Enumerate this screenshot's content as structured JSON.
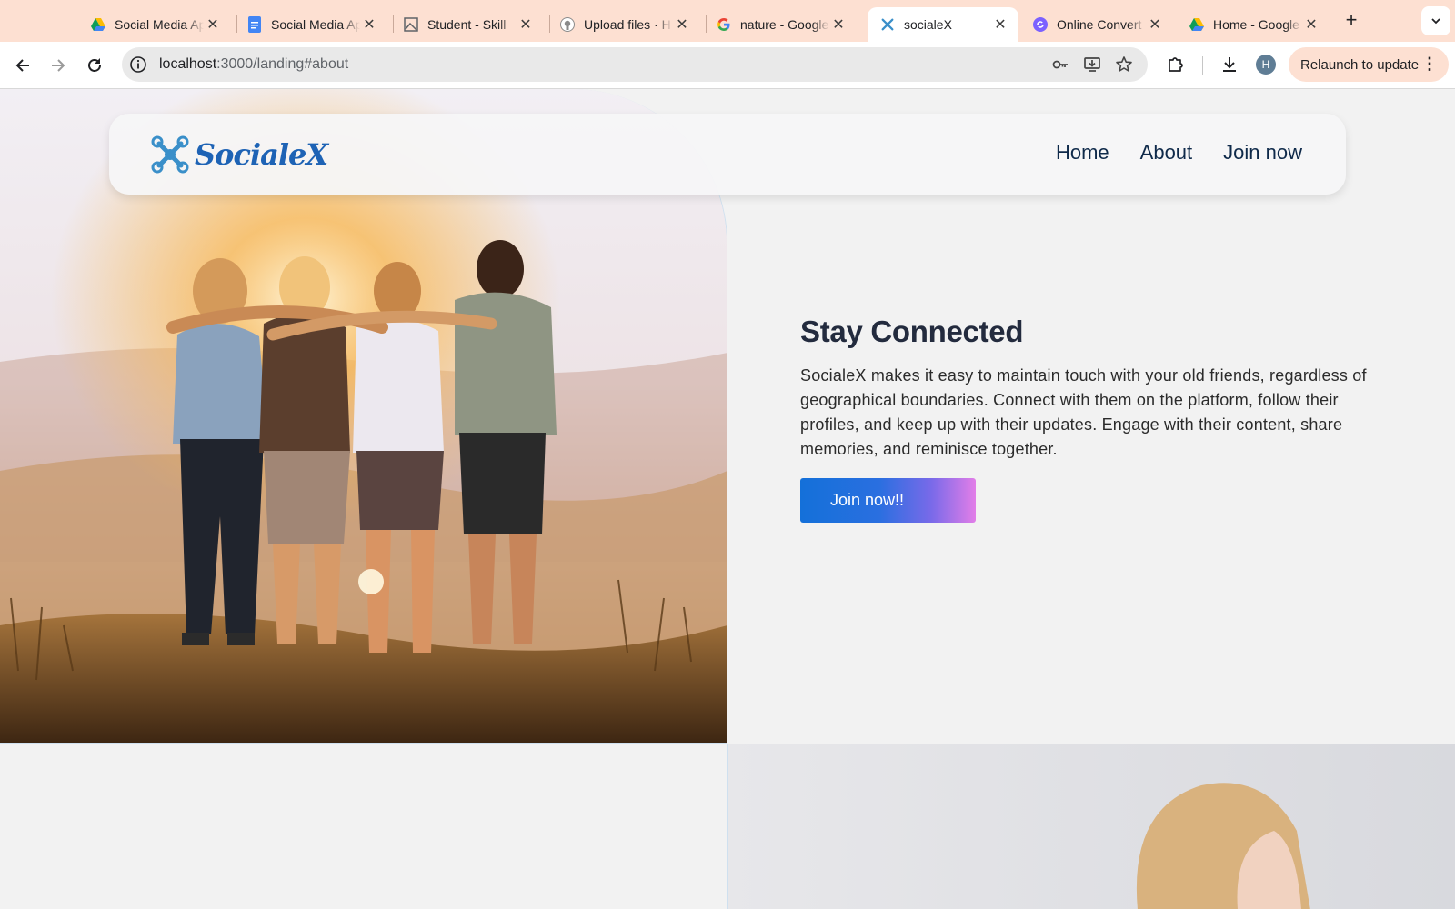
{
  "browser": {
    "tabs": [
      {
        "title": "Social Media Ap",
        "favicon": "google-drive-icon",
        "active": false
      },
      {
        "title": "Social Media Ap",
        "favicon": "google-docs-icon",
        "active": false
      },
      {
        "title": "Student - Skill",
        "favicon": "image-icon",
        "active": false
      },
      {
        "title": "Upload files · H",
        "favicon": "github-icon",
        "active": false
      },
      {
        "title": "nature - Google",
        "favicon": "google-icon",
        "active": false
      },
      {
        "title": "socialeX",
        "favicon": "socialex-icon",
        "active": true
      },
      {
        "title": "Online Convert",
        "favicon": "convert-icon",
        "active": false
      },
      {
        "title": "Home - Google",
        "favicon": "google-drive-icon",
        "active": false
      }
    ],
    "url_host": "localhost",
    "url_path": ":3000/landing#about",
    "profile_initial": "H",
    "relaunch_label": "Relaunch to update",
    "colors": {
      "chrome_bg": "#fde0d2",
      "omnibox_bg": "#e9e9e9"
    }
  },
  "site": {
    "logo_text": "SocialeX",
    "nav": {
      "home": "Home",
      "about": "About",
      "join": "Join now"
    },
    "section": {
      "heading": "Stay Connected",
      "body": "SocialeX makes it easy to maintain touch with your old friends, regardless of geographical boundaries. Connect with them on the platform, follow their profiles, and keep up with their updates. Engage with their content, share memories, and reminisce together.",
      "cta_label": "Join now!!"
    },
    "colors": {
      "brand": "#1e63b5",
      "heading": "#232b3e",
      "nav_text": "#0f2a4a"
    }
  }
}
